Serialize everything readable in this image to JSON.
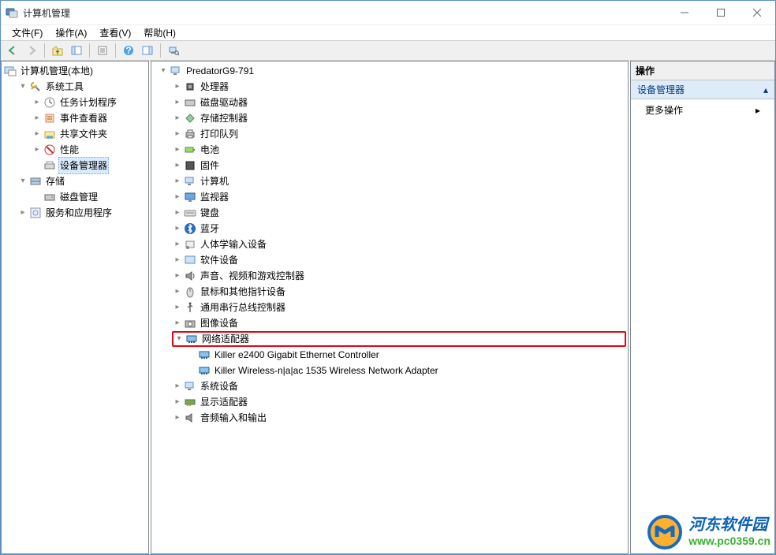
{
  "title": "计算机管理",
  "menu": {
    "file": "文件(F)",
    "action": "操作(A)",
    "view": "查看(V)",
    "help": "帮助(H)"
  },
  "left_tree": {
    "root": "计算机管理(本地)",
    "system_tools": "系统工具",
    "task_scheduler": "任务计划程序",
    "event_viewer": "事件查看器",
    "shared_folders": "共享文件夹",
    "performance": "性能",
    "device_manager": "设备管理器",
    "storage": "存储",
    "disk_management": "磁盘管理",
    "services_apps": "服务和应用程序"
  },
  "devices": {
    "root": "PredatorG9-791",
    "cpu": "处理器",
    "disk_drive": "磁盘驱动器",
    "storage_controller": "存储控制器",
    "print_queue": "打印队列",
    "battery": "电池",
    "firmware": "固件",
    "computer": "计算机",
    "monitor": "监视器",
    "keyboard": "键盘",
    "bluetooth": "蓝牙",
    "hid": "人体学输入设备",
    "software_device": "软件设备",
    "sound": "声音、视频和游戏控制器",
    "mouse": "鼠标和其他指针设备",
    "usb": "通用串行总线控制器",
    "imaging": "图像设备",
    "network": "网络适配器",
    "net1": "Killer e2400 Gigabit Ethernet Controller",
    "net2": "Killer Wireless-n|a|ac 1535 Wireless Network Adapter",
    "system_device": "系统设备",
    "display": "显示适配器",
    "audio_io": "音频输入和输出"
  },
  "actions": {
    "header": "操作",
    "context": "设备管理器",
    "more": "更多操作"
  },
  "watermark": {
    "cn": "河东软件园",
    "url": "www.pc0359.cn"
  }
}
